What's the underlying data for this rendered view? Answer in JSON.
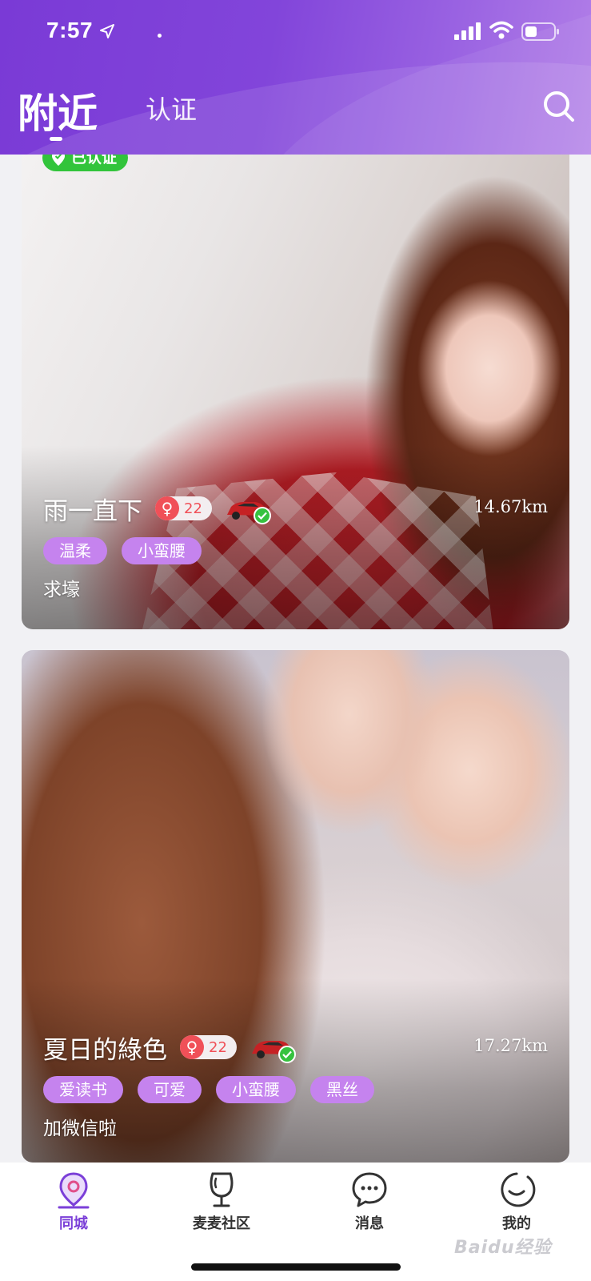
{
  "status_bar": {
    "time": "7:57"
  },
  "header": {
    "title": "附近",
    "tab_2": "认证"
  },
  "cards": [
    {
      "badge": "已认证",
      "name": "雨一直下",
      "sex_symbol": "♀",
      "age": "22",
      "distance": "14.67km",
      "tags": [
        "温柔",
        "小蛮腰"
      ],
      "bio": "求壕"
    },
    {
      "name": "夏日的綠色",
      "sex_symbol": "♀",
      "age": "22",
      "distance": "17.27km",
      "tags": [
        "爱读书",
        "可爱",
        "小蛮腰",
        "黑丝"
      ],
      "bio": "加微信啦"
    }
  ],
  "tabbar": {
    "items": [
      {
        "label": "同城",
        "icon": "location-pin-icon",
        "active": true
      },
      {
        "label": "麦麦社区",
        "icon": "wine-glass-icon",
        "active": false
      },
      {
        "label": "消息",
        "icon": "chat-bubble-icon",
        "active": false
      },
      {
        "label": "我的",
        "icon": "smiley-face-icon",
        "active": false
      }
    ]
  },
  "watermark": "Baidu经验",
  "colors": {
    "header_purple": "#8245da",
    "accent_purple": "#7b3fd8",
    "tag_purple": "#c583ee",
    "verified_green": "#32c43b",
    "female_red": "#f05058"
  }
}
